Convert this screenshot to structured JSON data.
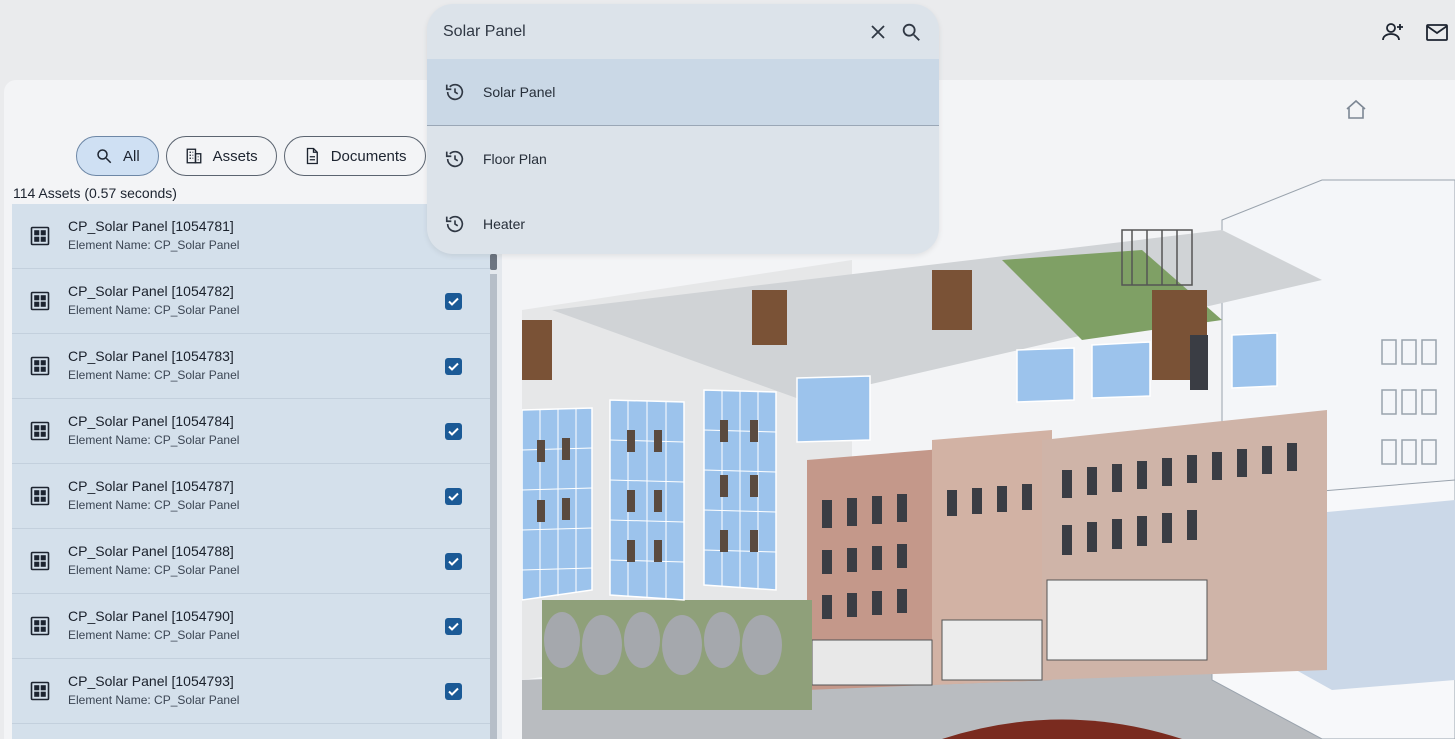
{
  "search": {
    "value": "Solar Panel",
    "suggestions": [
      {
        "label": "Solar Panel",
        "icon": "history-icon"
      },
      {
        "label": "Floor Plan",
        "icon": "history-icon"
      },
      {
        "label": "Heater",
        "icon": "history-icon"
      }
    ]
  },
  "filters": {
    "all": "All",
    "assets": "Assets",
    "documents": "Documents"
  },
  "results": {
    "summary": "114 Assets (0.57 seconds)",
    "items": [
      {
        "title": "CP_Solar Panel [1054781]",
        "subtitle": "Element Name: CP_Solar Panel",
        "checked": false
      },
      {
        "title": "CP_Solar Panel [1054782]",
        "subtitle": "Element Name: CP_Solar Panel",
        "checked": true
      },
      {
        "title": "CP_Solar Panel [1054783]",
        "subtitle": "Element Name: CP_Solar Panel",
        "checked": true
      },
      {
        "title": "CP_Solar Panel [1054784]",
        "subtitle": "Element Name: CP_Solar Panel",
        "checked": true
      },
      {
        "title": "CP_Solar Panel [1054787]",
        "subtitle": "Element Name: CP_Solar Panel",
        "checked": true
      },
      {
        "title": "CP_Solar Panel [1054788]",
        "subtitle": "Element Name: CP_Solar Panel",
        "checked": true
      },
      {
        "title": "CP_Solar Panel [1054790]",
        "subtitle": "Element Name: CP_Solar Panel",
        "checked": true
      },
      {
        "title": "CP_Solar Panel [1054793]",
        "subtitle": "Element Name: CP_Solar Panel",
        "checked": true
      }
    ]
  },
  "header_icons": [
    "add-user-icon",
    "mail-icon"
  ],
  "colors": {
    "accent": "#1b5a96",
    "chip_active": "#cfe0f3",
    "list_bg": "#d4e0eb",
    "solar_panel": "#9cc3ec"
  }
}
